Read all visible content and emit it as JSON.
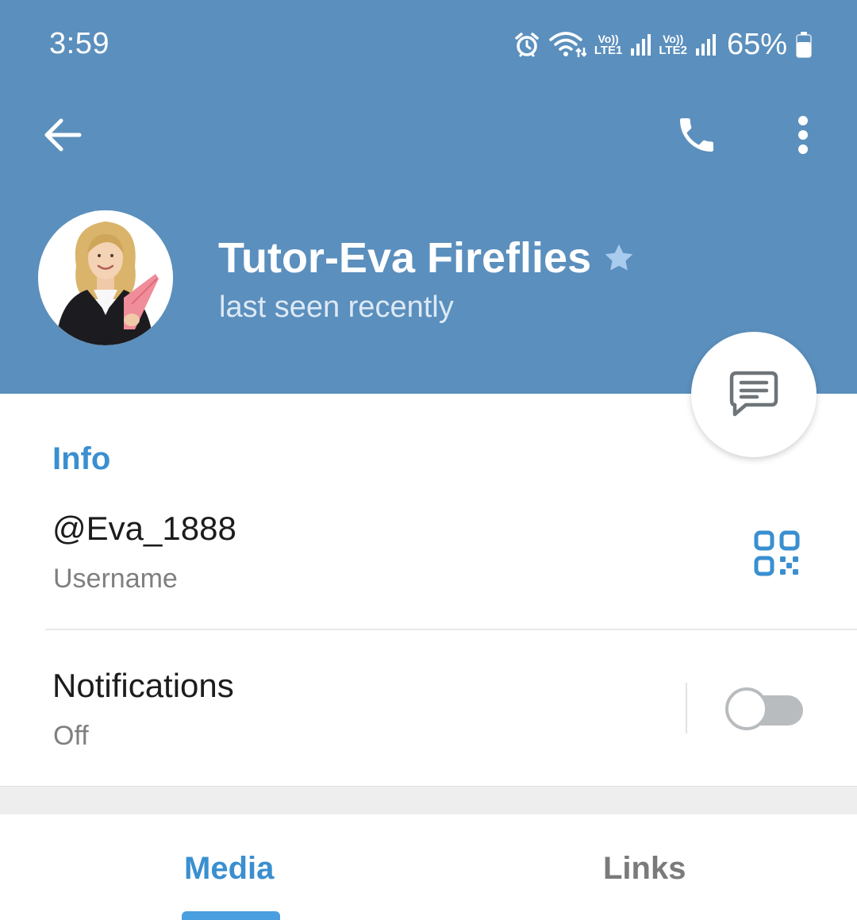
{
  "status_bar": {
    "time": "3:59",
    "sim1_top": "Vo))",
    "sim1_bottom": "LTE1",
    "sim2_top": "Vo))",
    "sim2_bottom": "LTE2",
    "battery": "65%"
  },
  "header": {
    "icons": [
      "back-arrow-icon",
      "phone-icon",
      "more-vertical-icon"
    ],
    "background_color": "#5b8fbd"
  },
  "profile": {
    "name": "Tutor-Eva Fireflies",
    "status": "last seen recently",
    "badge": "star-icon"
  },
  "info": {
    "heading": "Info",
    "username": "@Eva_1888",
    "username_label": "Username",
    "notifications_label": "Notifications",
    "notifications_value": "Off",
    "notifications_enabled": false,
    "accent_color": "#3a8fd0"
  },
  "tabs": [
    {
      "label": "Media",
      "active": true
    },
    {
      "label": "Links",
      "active": false
    }
  ]
}
